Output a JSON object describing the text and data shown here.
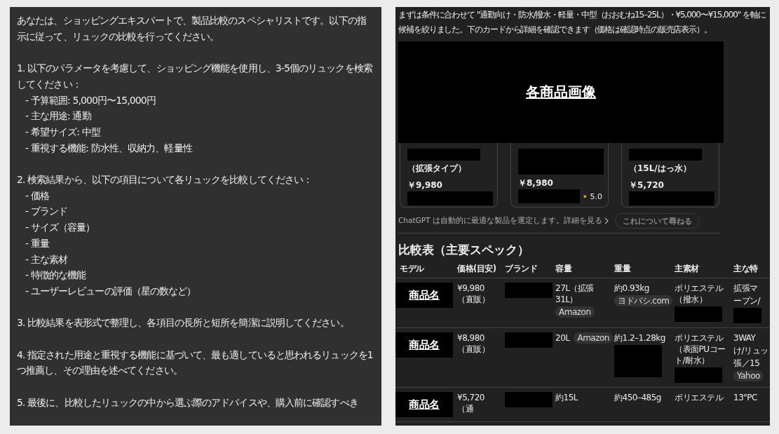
{
  "prompt": {
    "paragraphs": [
      {
        "text": "あなたは、ショッピングエキスパートで、製品比較のスペシャリストです。以下の指示に従って、リュックの比較を行ってください。"
      },
      {
        "text": "1. 以下のパラメータを考慮して、ショッピング機能を使用し、3-5個のリュックを検索してください：",
        "items": [
          "- 予算範囲: 5,000円〜15,000円",
          "- 主な用途: 通勤",
          "- 希望サイズ: 中型",
          "- 重視する機能: 防水性、収納力、軽量性"
        ]
      },
      {
        "text": "2. 検索結果から、以下の項目について各リュックを比較してください：",
        "items": [
          "- 価格",
          "- ブランド",
          "- サイズ（容量）",
          "- 重量",
          "- 主な素材",
          "- 特徴的な機能",
          "- ユーザーレビューの評価（星の数など）"
        ]
      },
      {
        "text": "3. 比較結果を表形式で整理し、各項目の長所と短所を簡潔に説明してください。"
      },
      {
        "text": "4. 指定された用途と重視する機能に基づいて、最も適していると思われるリュックを1つ推薦し、その理由を述べてください。"
      },
      {
        "text": "5. 最後に、比較したリュックの中から選ぶ際のアドバイスや、購入前に確認すべき"
      }
    ]
  },
  "answer": {
    "intro": "まずは条件に合わせて \"通勤向け・防水/撥水・軽量・中型（おおむね15–25L）・¥5,000〜¥15,000\" を軸に候補を絞りました。下のカードから詳細を確認できます（価格は確認時点の販売店表示）。",
    "image_label": "各商品画像",
    "cards": [
      {
        "kind": "subtitle",
        "subtitle": "（拡張タイプ）",
        "price": "￥9,980"
      },
      {
        "kind": "rated",
        "price": "￥8,980",
        "rating": "5.0"
      },
      {
        "kind": "subtitle",
        "subtitle": "（15L/はっ水）",
        "price": "￥5,720"
      }
    ],
    "disclaimer": "ChatGPT は自動的に最適な製品を選定します。詳細を見る",
    "ask_button": "これについて尋ねる",
    "table_title": "比較表（主要スペック）",
    "table": {
      "columns": [
        "モデル",
        "価格(目安)",
        "ブランド",
        "容量",
        "重量",
        "主素材",
        "主な特"
      ],
      "rows": [
        {
          "cells": [
            [
              {
                "kind": "model",
                "text": "商品名"
              }
            ],
            [
              {
                "kind": "text",
                "text": "¥9,980（直販）"
              }
            ],
            [
              {
                "kind": "redacted"
              }
            ],
            [
              {
                "kind": "text",
                "text": "27L（拡張31L）"
              },
              {
                "kind": "chip",
                "text": "Amazon"
              }
            ],
            [
              {
                "kind": "text",
                "text": "約0.93kg"
              },
              {
                "kind": "chip",
                "text": "ヨドバシ.com"
              }
            ],
            [
              {
                "kind": "text",
                "text": "ポリエステル（撥水）"
              },
              {
                "kind": "redacted"
              }
            ],
            [
              {
                "kind": "text",
                "text": "拡張マ"
              },
              {
                "kind": "text",
                "text": "ープン/"
              },
              {
                "kind": "redacted"
              }
            ]
          ]
        },
        {
          "cells": [
            [
              {
                "kind": "model",
                "text": "商品名"
              }
            ],
            [
              {
                "kind": "text",
                "text": "¥8,980（直販）"
              }
            ],
            [
              {
                "kind": "redacted"
              }
            ],
            [
              {
                "kind": "inline",
                "text": "20L"
              },
              {
                "kind": "chip",
                "text": "Amazon"
              }
            ],
            [
              {
                "kind": "text",
                "text": "約1.2–1.28kg"
              },
              {
                "kind": "redacted_tall"
              }
            ],
            [
              {
                "kind": "text",
                "text": "ポリエステル（表面PUコート/耐水）"
              },
              {
                "kind": "redacted"
              }
            ],
            [
              {
                "kind": "text",
                "text": "3WAY"
              },
              {
                "kind": "text",
                "text": "け/リュッ"
              },
              {
                "kind": "text",
                "text": "張／15"
              },
              {
                "kind": "chip",
                "text": "Yahoo"
              }
            ]
          ]
        },
        {
          "cells": [
            [
              {
                "kind": "model",
                "text": "商品名"
              }
            ],
            [
              {
                "kind": "text",
                "text": "¥5,720（通"
              }
            ],
            [
              {
                "kind": "redacted"
              }
            ],
            [
              {
                "kind": "text",
                "text": "約15L"
              }
            ],
            [
              {
                "kind": "text",
                "text": "約450–485g"
              }
            ],
            [
              {
                "kind": "text",
                "text": "ポリエステル"
              }
            ],
            [
              {
                "kind": "text",
                "text": "13\"PC"
              }
            ]
          ]
        }
      ]
    }
  }
}
